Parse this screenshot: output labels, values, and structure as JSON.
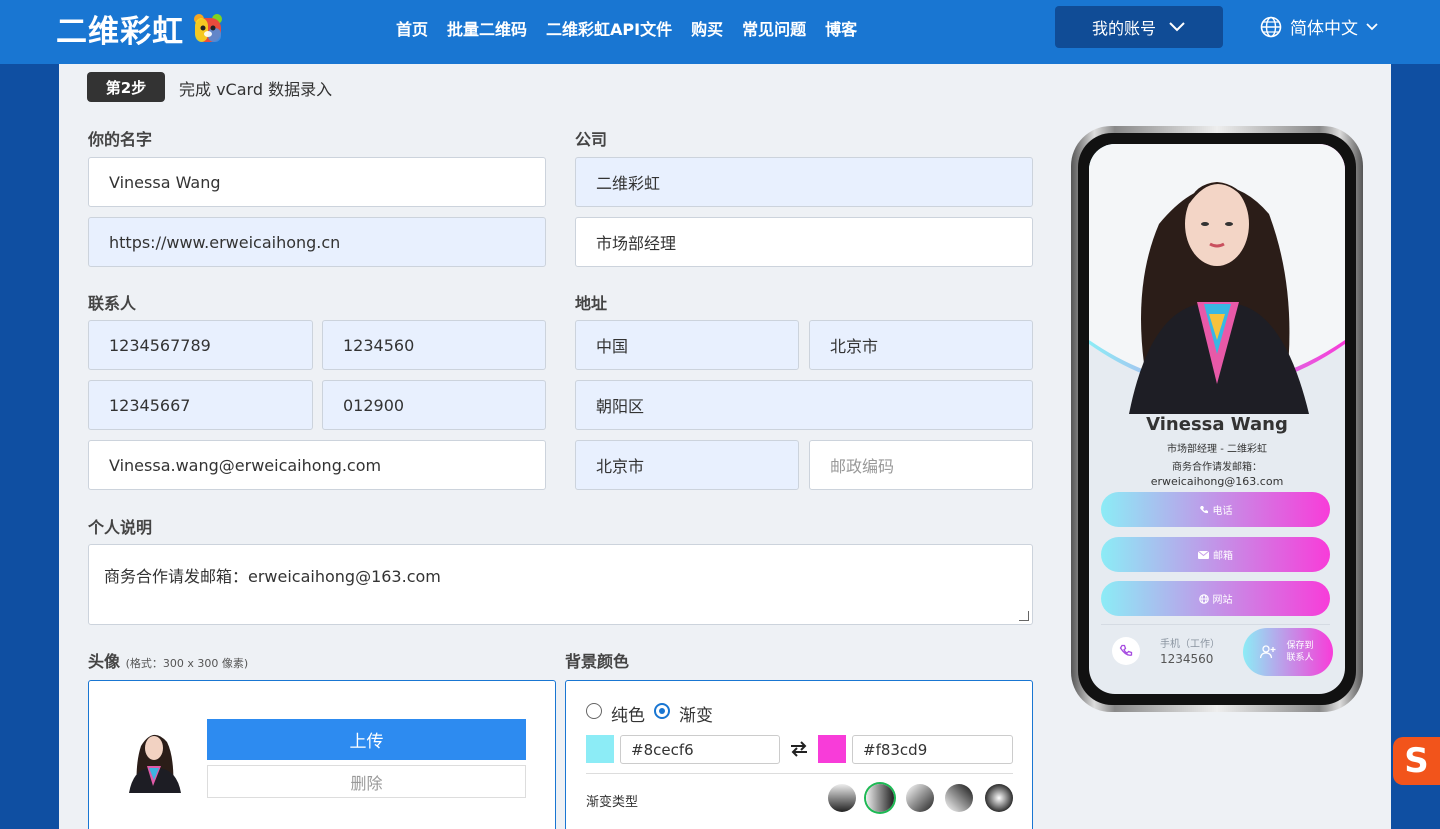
{
  "header": {
    "logo_text": "二维彩虹",
    "nav": [
      "首页",
      "批量二维码",
      "二维彩虹API文件",
      "购买",
      "常见问题",
      "博客"
    ],
    "account_label": "我的账号",
    "language": "简体中文"
  },
  "step": {
    "badge": "第2步",
    "title": "完成 vCard 数据录入"
  },
  "form": {
    "name_label": "你的名字",
    "name_value": "Vinessa Wang",
    "website_value": "https://www.erweicaihong.cn",
    "company_label": "公司",
    "company_value": "二维彩虹",
    "position_value": "市场部经理",
    "contact_label": "联系人",
    "phone_mobile": "1234567789",
    "phone_work": "1234560",
    "phone_home": "12345667",
    "fax": "012900",
    "email": "Vinessa.wang@erweicaihong.com",
    "address_label": "地址",
    "country": "中国",
    "province": "北京市",
    "district": "朝阳区",
    "city": "北京市",
    "postcode_placeholder": "邮政编码",
    "bio_label": "个人说明",
    "bio_value": "商务合作请发邮箱：erweicaihong@163.com"
  },
  "avatar": {
    "label": "头像",
    "hint": "(格式：300 x 300 像素)",
    "upload_label": "上传",
    "delete_label": "删除"
  },
  "background": {
    "label": "背景颜色",
    "option_solid": "纯色",
    "option_gradient": "渐变",
    "selected": "渐变",
    "color_start": "#8cecf6",
    "color_end": "#f83cd9",
    "gradient_type_label": "渐变类型"
  },
  "preview": {
    "name": "Vinessa Wang",
    "subtitle": "市场部经理 - 二维彩虹",
    "bio_line1": "商务合作请发邮箱：",
    "bio_line2": "erweicaihong@163.com",
    "btn_phone": "电话",
    "btn_email": "邮箱",
    "btn_website": "网站",
    "phone_label": "手机（工作）",
    "phone_value": "1234560",
    "save_contact": "保存到联系人"
  }
}
